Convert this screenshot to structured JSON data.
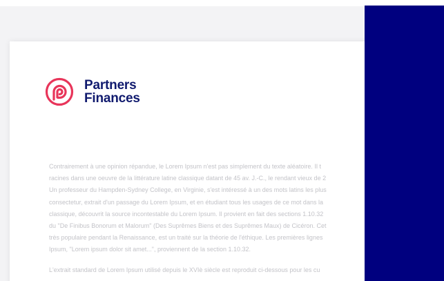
{
  "logo": {
    "line1": "Partners",
    "line2": "Finances",
    "mark_color": "#e8355a",
    "text_color": "#101a6e"
  },
  "document": {
    "paragraph1": [
      "Contrairement à une opinion répandue, le Lorem Ipsum n'est pas simplement du texte aléatoire. Il t",
      "racines dans une oeuvre de la littérature latine classique datant de 45 av. J.-C., le rendant vieux de 2",
      "Un professeur du Hampden-Sydney College, en Virginie, s'est intéressé à un des mots latins les plus",
      "consectetur, extrait d'un passage du Lorem Ipsum, et en étudiant tous les usages de ce mot dans la",
      "classique, découvrit la source incontestable du Lorem Ipsum. Il provient en fait des sections 1.10.32",
      "du \"De Finibus Bonorum et Malorum\" (Des Suprêmes Biens et des Suprêmes Maux) de Cicéron. Cet",
      "très populaire pendant la Renaissance, est un traité sur la théorie de l'éthique. Les premières lignes",
      "Ipsum, \"Lorem ipsum dolor sit amet...\", proviennent de la section 1.10.32."
    ],
    "paragraph2": [
      "L'extrait standard de Lorem Ipsum utilisé depuis le XVIè siècle est reproduit ci-dessous pour les cu"
    ]
  },
  "colors": {
    "side_panel": "#00007f",
    "body_text": "#c3c3c8",
    "background": "#f3f3f5"
  }
}
